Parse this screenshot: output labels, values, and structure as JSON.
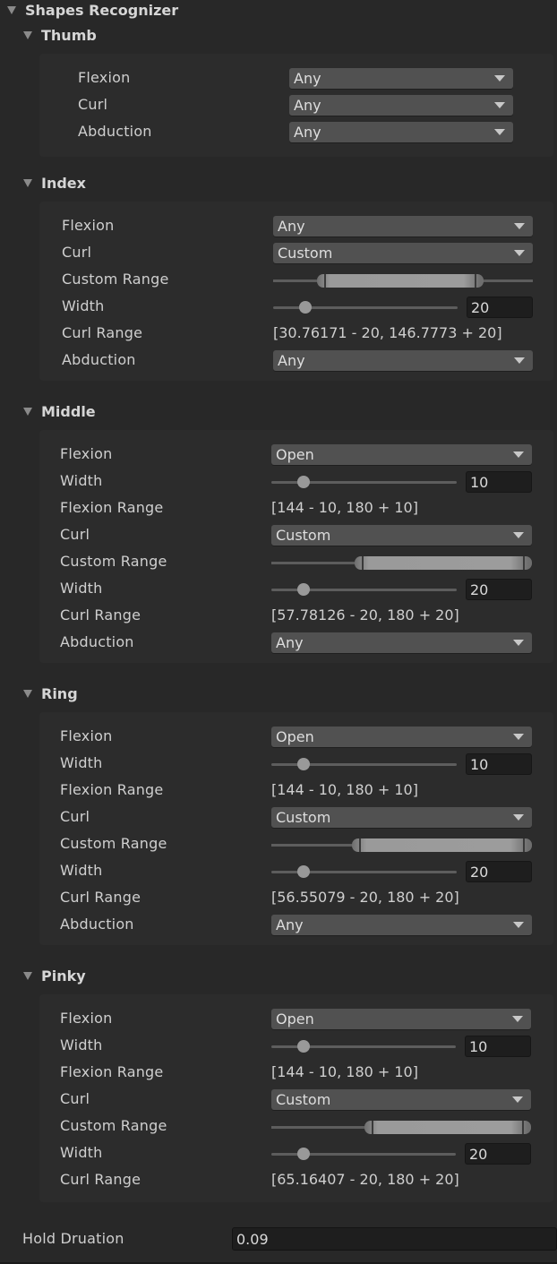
{
  "component": {
    "title": "Shapes Recognizer"
  },
  "fingers": [
    {
      "name": "Thumb",
      "rows": [
        {
          "type": "dropdown",
          "label": "Flexion",
          "value": "Any"
        },
        {
          "type": "dropdown",
          "label": "Curl",
          "value": "Any"
        },
        {
          "type": "dropdown",
          "label": "Abduction",
          "value": "Any"
        }
      ]
    },
    {
      "name": "Index",
      "rows": [
        {
          "type": "dropdown",
          "label": "Flexion",
          "value": "Any"
        },
        {
          "type": "dropdown",
          "label": "Curl",
          "value": "Custom"
        },
        {
          "type": "minmax",
          "label": "Custom Range",
          "min_fraction": 0.17,
          "max_fraction": 0.81
        },
        {
          "type": "slider",
          "label": "Width",
          "value": "20",
          "fraction": 0.1
        },
        {
          "type": "text",
          "label": "Curl Range",
          "value": "[30.76171 - 20, 146.7773 + 20]"
        },
        {
          "type": "dropdown",
          "label": "Abduction",
          "value": "Any"
        }
      ]
    },
    {
      "name": "Middle",
      "rows": [
        {
          "type": "dropdown",
          "label": "Flexion",
          "value": "Open"
        },
        {
          "type": "slider",
          "label": "Width",
          "value": "10",
          "fraction": 0.1
        },
        {
          "type": "text",
          "label": "Flexion Range",
          "value": "[144 - 10, 180 + 10]"
        },
        {
          "type": "dropdown",
          "label": "Curl",
          "value": "Custom"
        },
        {
          "type": "minmax",
          "label": "Custom Range",
          "min_fraction": 0.32,
          "max_fraction": 1.0
        },
        {
          "type": "slider",
          "label": "Width",
          "value": "20",
          "fraction": 0.1
        },
        {
          "type": "text",
          "label": "Curl Range",
          "value": "[57.78126 - 20, 180 + 20]"
        },
        {
          "type": "dropdown",
          "label": "Abduction",
          "value": "Any"
        }
      ]
    },
    {
      "name": "Ring",
      "rows": [
        {
          "type": "dropdown",
          "label": "Flexion",
          "value": "Open"
        },
        {
          "type": "slider",
          "label": "Width",
          "value": "10",
          "fraction": 0.1
        },
        {
          "type": "text",
          "label": "Flexion Range",
          "value": "[144 - 10, 180 + 10]"
        },
        {
          "type": "dropdown",
          "label": "Curl",
          "value": "Custom"
        },
        {
          "type": "minmax",
          "label": "Custom Range",
          "min_fraction": 0.31,
          "max_fraction": 1.0
        },
        {
          "type": "slider",
          "label": "Width",
          "value": "20",
          "fraction": 0.1
        },
        {
          "type": "text",
          "label": "Curl Range",
          "value": "[56.55079 - 20, 180 + 20]"
        },
        {
          "type": "dropdown",
          "label": "Abduction",
          "value": "Any"
        }
      ]
    },
    {
      "name": "Pinky",
      "rows": [
        {
          "type": "dropdown",
          "label": "Flexion",
          "value": "Open"
        },
        {
          "type": "slider",
          "label": "Width",
          "value": "10",
          "fraction": 0.1
        },
        {
          "type": "text",
          "label": "Flexion Range",
          "value": "[144 - 10, 180 + 10]"
        },
        {
          "type": "dropdown",
          "label": "Curl",
          "value": "Custom"
        },
        {
          "type": "minmax",
          "label": "Custom Range",
          "min_fraction": 0.36,
          "max_fraction": 1.0
        },
        {
          "type": "slider",
          "label": "Width",
          "value": "20",
          "fraction": 0.1
        },
        {
          "type": "text",
          "label": "Curl Range",
          "value": "[65.16407 - 20, 180 + 20]"
        }
      ]
    }
  ],
  "hold_duration": {
    "label": "Hold Druation",
    "value": "0.09"
  }
}
